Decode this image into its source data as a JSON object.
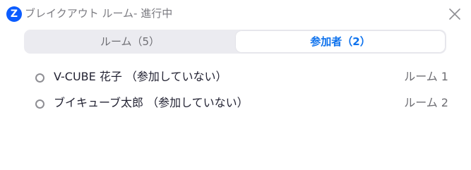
{
  "window": {
    "title": "ブレイクアウト ルーム- 進行中",
    "app_icon_letter": "Z",
    "close_icon": "close-icon"
  },
  "tabs": [
    {
      "label": "ルーム（5）",
      "selected": false
    },
    {
      "label": "参加者（2）",
      "selected": true
    }
  ],
  "participants": [
    {
      "name": "V-CUBE 花子 （参加していない）",
      "room": "ルーム 1"
    },
    {
      "name": "ブイキューブ太郎 （参加していない）",
      "room": "ルーム 2"
    }
  ],
  "colors": {
    "accent": "#0e72ed",
    "app_icon": "#0b5cff",
    "tab_bar": "#ebebf0"
  }
}
